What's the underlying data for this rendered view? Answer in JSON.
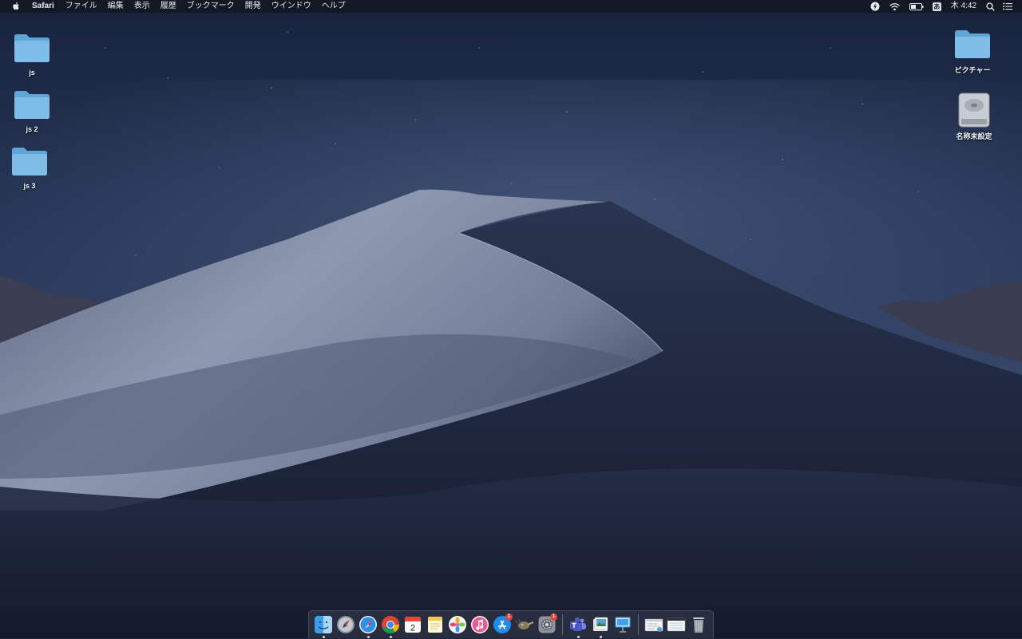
{
  "menubar": {
    "apple_icon": "apple-icon",
    "app_name": "Safari",
    "menus": [
      "ファイル",
      "編集",
      "表示",
      "履歴",
      "ブックマーク",
      "開発",
      "ウインドウ",
      "ヘルプ"
    ],
    "status_icons": [
      "lightning-icon",
      "wifi-icon",
      "battery-icon"
    ],
    "input_method": "あ",
    "clock": "木 4:42",
    "right_icons": [
      "search-icon",
      "list-icon"
    ]
  },
  "desktop": {
    "left_icons": [
      {
        "label": "js",
        "icon": "folder-icon"
      },
      {
        "label": "js 2",
        "icon": "folder-icon"
      },
      {
        "label": "js 3",
        "icon": "folder-icon"
      }
    ],
    "right_icons": [
      {
        "label": "ピクチャー",
        "icon": "folder-icon"
      },
      {
        "label": "名称未設定",
        "icon": "hard-drive-icon"
      }
    ]
  },
  "dock": {
    "items": [
      {
        "icon": "finder-icon",
        "running": true
      },
      {
        "icon": "launchpad-icon",
        "running": false
      },
      {
        "icon": "safari-icon",
        "running": true
      },
      {
        "icon": "chrome-icon",
        "running": true
      },
      {
        "icon": "calendar-icon",
        "running": false,
        "day": "2"
      },
      {
        "icon": "notes-icon",
        "running": false
      },
      {
        "icon": "photos-icon",
        "running": false
      },
      {
        "icon": "itunes-icon",
        "running": false
      },
      {
        "icon": "app-store-icon",
        "running": false,
        "badge": "1"
      },
      {
        "icon": "gimp-icon",
        "running": false
      },
      {
        "icon": "system-preferences-icon",
        "running": false,
        "badge": "1"
      },
      {
        "icon": "teams-icon",
        "running": true
      },
      {
        "icon": "preview-icon",
        "running": true
      },
      {
        "icon": "keynote-icon",
        "running": false
      },
      {
        "icon": "window-thumbnail-icon",
        "running": false
      },
      {
        "icon": "window-thumbnail-icon",
        "running": false
      },
      {
        "icon": "trash-icon",
        "running": false
      }
    ]
  },
  "colors": {
    "sky_top": "#1a2844",
    "sky_bottom": "#3d4f72",
    "dune_light": "#8a94ab",
    "dune_dark": "#141a2c",
    "folder": "#6eb2e0"
  }
}
